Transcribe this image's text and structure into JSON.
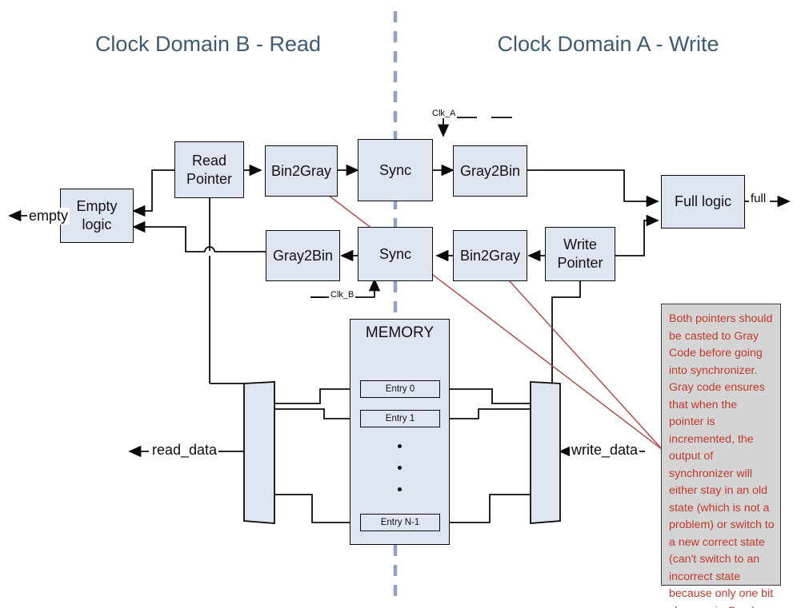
{
  "diagram": {
    "title_left": "Clock Domain B - Read",
    "title_right": "Clock Domain A - Write",
    "divider": "clock-domain-divider"
  },
  "colors": {
    "block_fill": "#dee4f0",
    "block_stroke": "#0b0b0b",
    "title_text": "#3d5a73",
    "divider": "#8fa3bf",
    "note_text": "#c0392b",
    "note_fill": "#d4d4d4",
    "pointer_line": "#b5413f"
  },
  "blocks": {
    "empty_logic": "Empty\nlogic",
    "read_pointer": "Read\nPointer",
    "bin2gray_top": "Bin2Gray",
    "sync_top": "Sync",
    "gray2bin_top": "Gray2Bin",
    "full_logic": "Full logic",
    "gray2bin_bottom": "Gray2Bin",
    "sync_bottom": "Sync",
    "bin2gray_bottom": "Bin2Gray",
    "write_pointer": "Write\nPointer"
  },
  "memory": {
    "title": "MEMORY",
    "entries": [
      "Entry 0",
      "Entry 1",
      "Entry N-1"
    ],
    "ellipsis_dots": 3
  },
  "signals": {
    "empty": "empty",
    "full": "full",
    "read_data": "read_data",
    "write_data": "write_data",
    "clk_a": "Clk_A",
    "clk_b": "Clk_B"
  },
  "annotation": {
    "text": "Both pointers should be casted to Gray Code before going into synchronizer. Gray code ensures that when the pointer is incremented, the output of synchronizer will either stay in an old state (which is not a problem) or switch to a new correct state (can't switch to an incorrect state because only one bit changes in Gray)"
  }
}
